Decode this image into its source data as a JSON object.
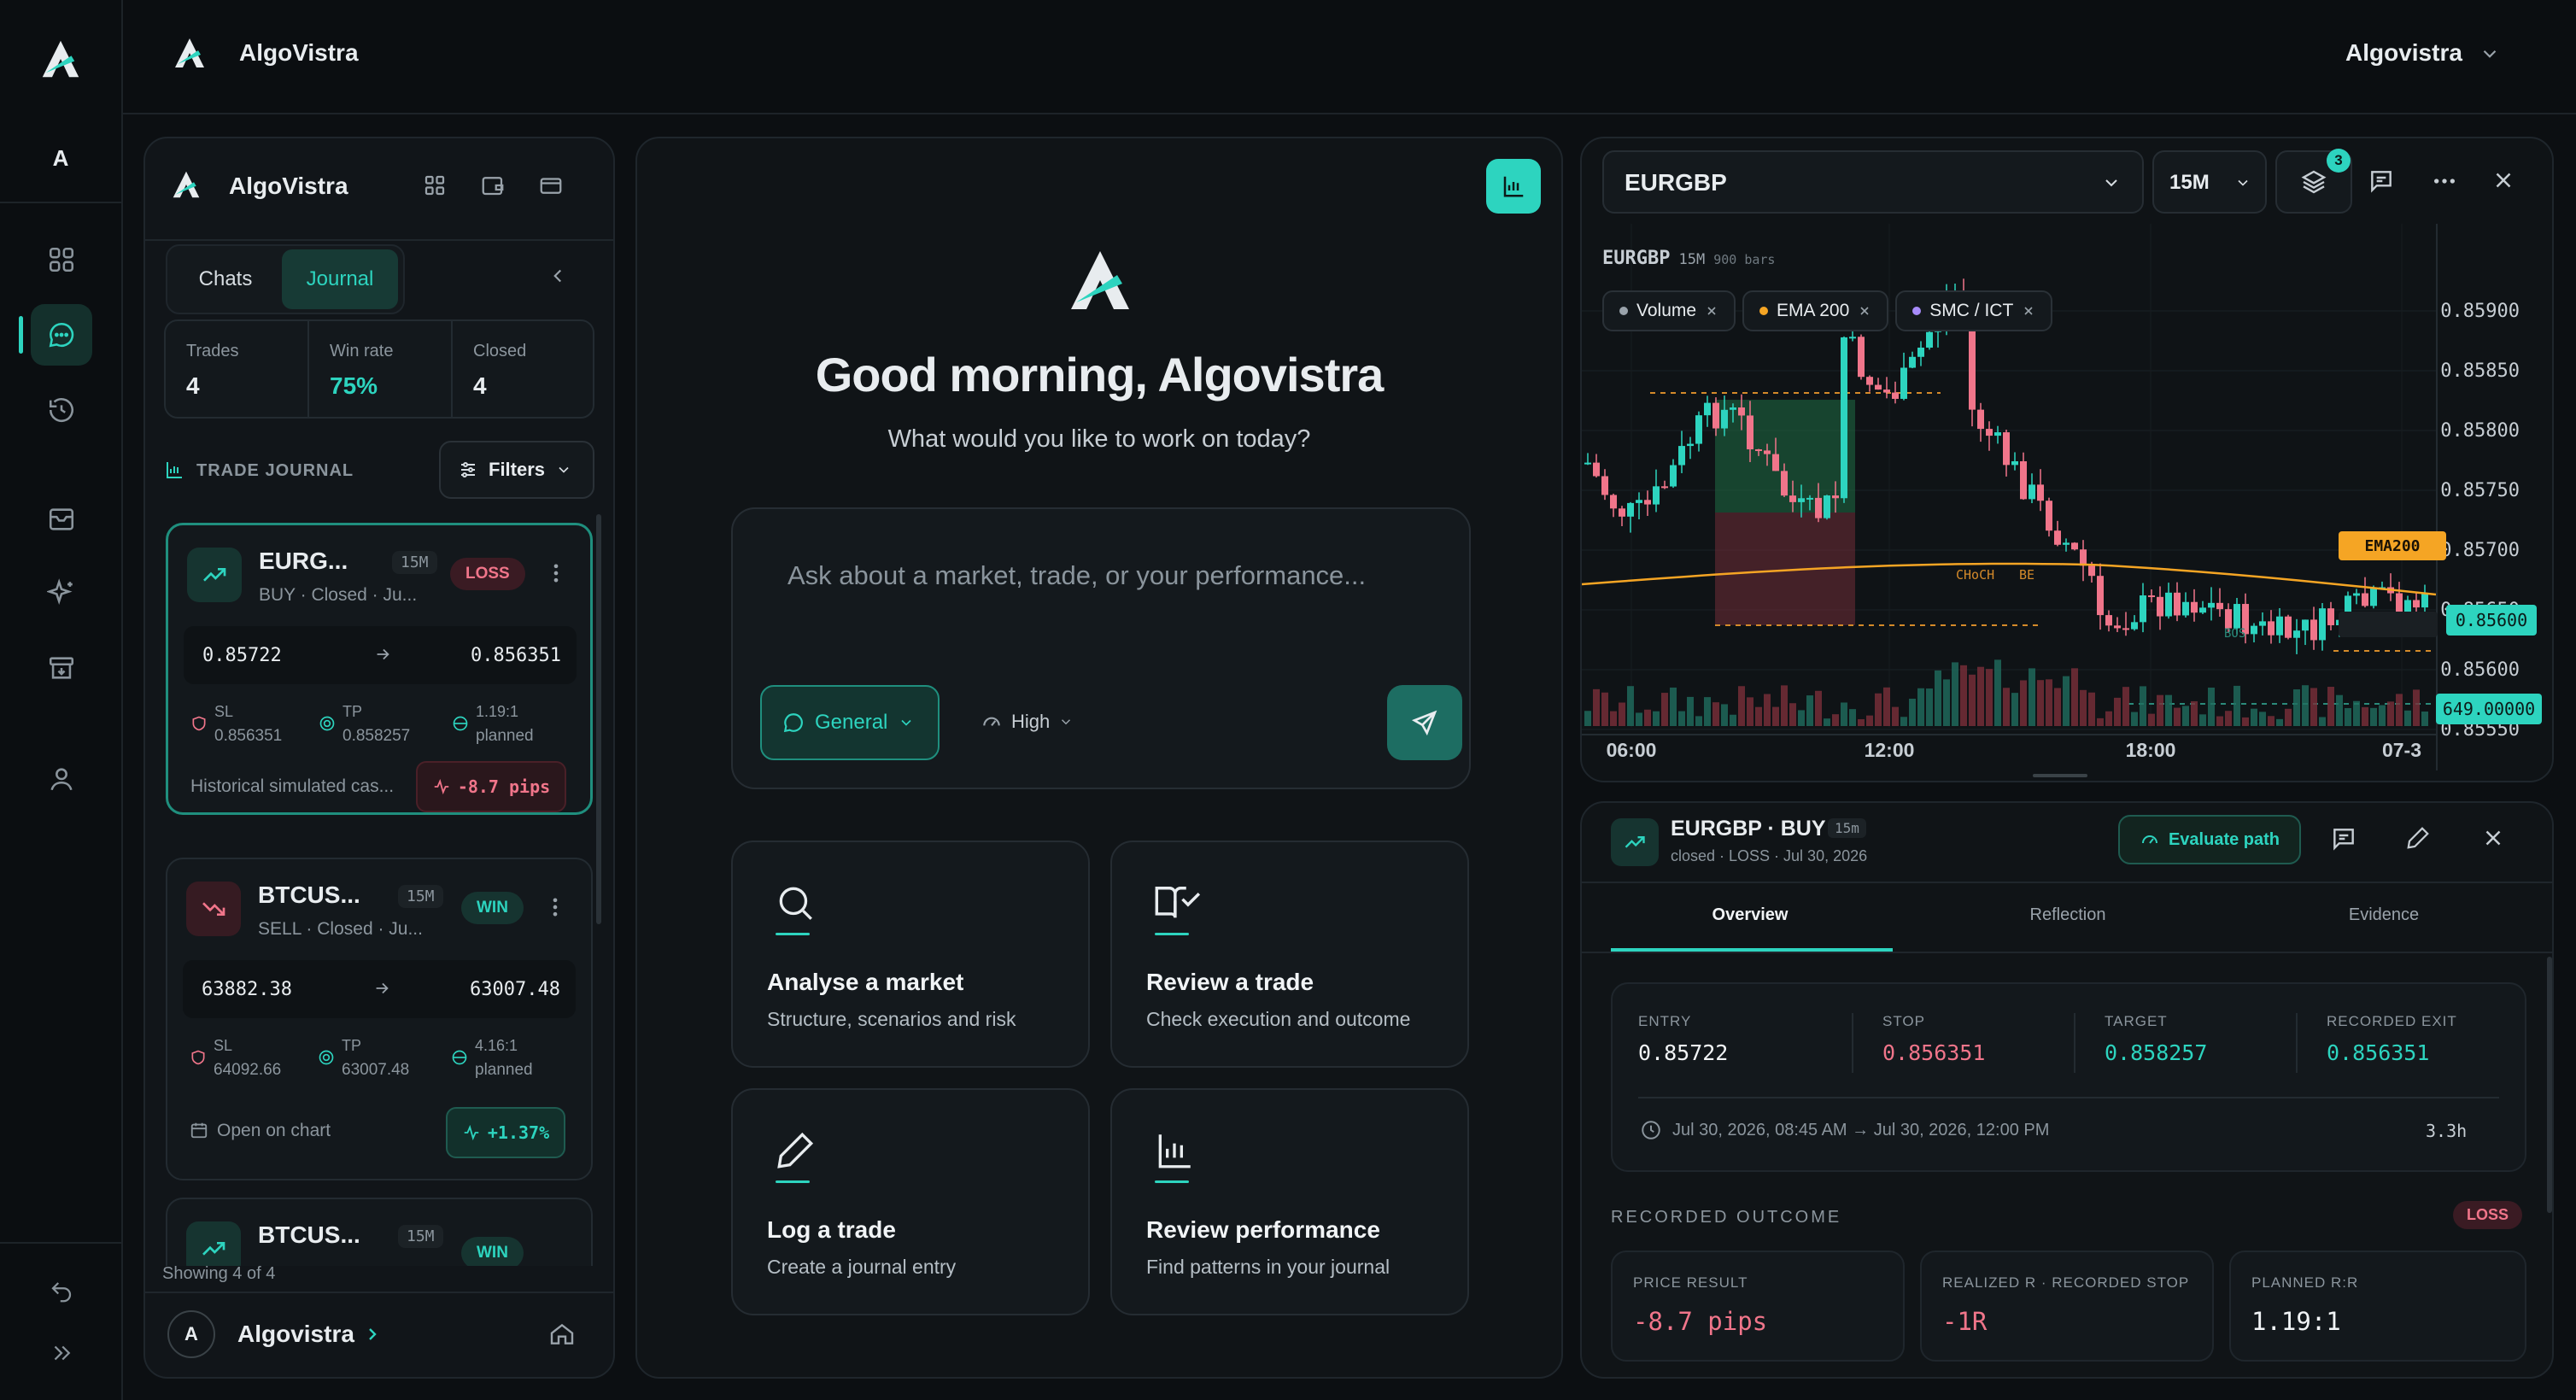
{
  "app": {
    "name": "AlgoVistra",
    "user_menu": "Algovistra",
    "rail_avatar": "A"
  },
  "sidebar": {
    "brand": "AlgoVistra",
    "tabs": [
      {
        "label": "Chats"
      },
      {
        "label": "Journal",
        "active": true
      }
    ],
    "stats": [
      {
        "label": "Trades",
        "value": "4"
      },
      {
        "label": "Win rate",
        "value": "75%"
      },
      {
        "label": "Closed",
        "value": "4"
      }
    ],
    "journal_title": "TRADE JOURNAL",
    "filters_label": "Filters",
    "trades": [
      {
        "symbol": "EURG...",
        "tf": "15M",
        "meta": "BUY · Closed · Ju...",
        "result": "LOSS",
        "entry": "0.85722",
        "exit": "0.856351",
        "sl_label": "SL",
        "sl": "0.856351",
        "tp_label": "TP",
        "tp": "0.858257",
        "rr": "1.19:1",
        "rr_label": "planned",
        "note": "Historical simulated cas...",
        "pnl": "-8.7 pips"
      },
      {
        "symbol": "BTCUS...",
        "tf": "15M",
        "meta": "SELL · Closed · Ju...",
        "result": "WIN",
        "entry": "63882.38",
        "exit": "63007.48",
        "sl_label": "SL",
        "sl": "64092.66",
        "tp_label": "TP",
        "tp": "63007.48",
        "rr": "4.16:1",
        "rr_label": "planned",
        "note": "Open on chart",
        "pnl": "+1.37%"
      },
      {
        "symbol": "BTCUS...",
        "tf": "15M",
        "result": "WIN"
      }
    ],
    "showing": "Showing 4 of 4",
    "footer_avatar": "A",
    "footer_name": "Algovistra"
  },
  "main": {
    "greeting": "Good morning, Algovistra",
    "subtitle": "What would you like to work on today?",
    "input_placeholder": "Ask about a market, trade, or your performance...",
    "mode_label": "General",
    "effort_label": "High",
    "quick_actions": [
      {
        "title": "Analyse a market",
        "subtitle": "Structure, scenarios and risk",
        "icon": "search-icon"
      },
      {
        "title": "Review a trade",
        "subtitle": "Check execution and outcome",
        "icon": "book-check-icon"
      },
      {
        "title": "Log a trade",
        "subtitle": "Create a journal entry",
        "icon": "pen-icon"
      },
      {
        "title": "Review performance",
        "subtitle": "Find patterns in your journal",
        "icon": "bar-chart-icon"
      }
    ]
  },
  "chart": {
    "symbol": "EURGBP",
    "timeframe": "15M",
    "layers_badge": "3",
    "info_symbol": "EURGBP",
    "info_tf": "15M",
    "info_bars": "900 bars",
    "indicators": [
      {
        "name": "Volume",
        "color": "#9aa3ab"
      },
      {
        "name": "EMA 200",
        "color": "#f5a524"
      },
      {
        "name": "SMC / ICT",
        "color": "#a78bfa"
      }
    ],
    "price_ticks": [
      "0.85900",
      "0.85850",
      "0.85800",
      "0.85750",
      "0.85700",
      "0.85650",
      "0.85600",
      "0.85550"
    ],
    "time_ticks": [
      "06:00",
      "12:00",
      "18:00",
      "07-3"
    ],
    "ema_label": "EMA200",
    "current_price": "0.85600",
    "volume_label": "649.00000",
    "annotations": {
      "choch": "CHoCH",
      "be": "BE",
      "bos": "BOS"
    }
  },
  "trade_detail": {
    "title": "EURGBP · BUY",
    "tf": "15m",
    "meta": "closed · LOSS · Jul 30, 2026",
    "evaluate_label": "Evaluate path",
    "tabs": [
      {
        "label": "Overview",
        "active": true
      },
      {
        "label": "Reflection"
      },
      {
        "label": "Evidence"
      }
    ],
    "levels": [
      {
        "label": "ENTRY",
        "value": "0.85722",
        "color": "#f1f4f6"
      },
      {
        "label": "STOP",
        "value": "0.856351",
        "color": "#f0758a"
      },
      {
        "label": "TARGET",
        "value": "0.858257",
        "color": "#2dd4bf"
      },
      {
        "label": "RECORDED EXIT",
        "value": "0.856351",
        "color": "#2dd4bf"
      }
    ],
    "timerange": "Jul 30, 2026, 08:45 AM → Jul 30, 2026, 12:00 PM",
    "duration": "3.3h",
    "outcome_title": "RECORDED OUTCOME",
    "outcome_badge": "LOSS",
    "outcome": [
      {
        "label": "PRICE RESULT",
        "value": "-8.7 pips",
        "color": "#f0758a"
      },
      {
        "label": "REALIZED R · RECORDED STOP",
        "value": "-1R",
        "color": "#f0758a"
      },
      {
        "label": "PLANNED R:R",
        "value": "1.19:1",
        "color": "#f1f4f6"
      }
    ]
  },
  "colors": {
    "accent": "#2dd4bf",
    "bull": "#2dd4bf",
    "bear": "#f0758a",
    "ema": "#f5a524",
    "bg": "#0c0f12"
  }
}
